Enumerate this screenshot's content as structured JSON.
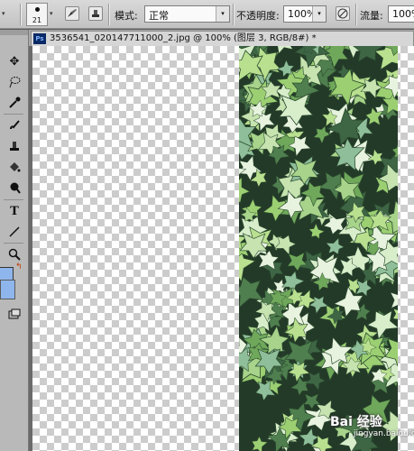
{
  "options_bar": {
    "brush_size": "21",
    "mode_label": "模式:",
    "mode_value": "正常",
    "opacity_label": "不透明度:",
    "opacity_value": "100%",
    "flow_label": "流量:",
    "flow_value": "100%"
  },
  "document": {
    "tab_title": "3536541_020147711000_2.jpg @ 100% (图层 3, RGB/8#) *"
  },
  "watermark": {
    "text": "Bai 经验",
    "sub": "jingyan.baidu.com"
  },
  "toolbar": {
    "tools": [
      "move-icon",
      "lasso-icon",
      "eyedropper-icon",
      "brush-icon",
      "clone-stamp-icon",
      "paint-bucket-icon",
      "dodge-icon",
      "type-icon",
      "line-icon",
      "zoom-icon",
      "screen-mode-icon"
    ]
  },
  "colors": {
    "foreground": "#8fb6ec",
    "background": "#8fb6ec",
    "ui_panel": "#b9b9b9"
  }
}
